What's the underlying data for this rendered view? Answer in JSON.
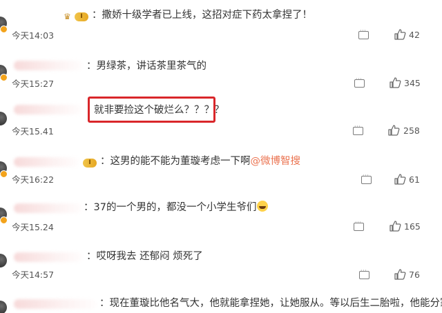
{
  "comments": [
    {
      "text": "：撒娇十级学者已上线，这招对症下药太拿捏了！",
      "time": "今天14:03",
      "likes": "42",
      "level": "I",
      "has_crown": true
    },
    {
      "text": "：男绿茶，讲话茶里茶气的",
      "time": "今天15:27",
      "likes": "345"
    },
    {
      "text": "就非要捡这个破烂么？？？？",
      "time": "今天15.41",
      "likes": "258",
      "highlighted": true
    },
    {
      "text_prefix": "：这男的能不能为董璇考虑一下啊",
      "mention": "@微博智搜",
      "time": "今天16:22",
      "likes": "61",
      "level": "I"
    },
    {
      "text": "：37的一个男的，都没一个小学生爷们",
      "time": "今天15.24",
      "likes": "165",
      "emoji": "laughing-emoji"
    },
    {
      "text": "：哎呀我去 还郁闷 烦死了",
      "time": "今天14:57",
      "likes": "76"
    },
    {
      "text": "：现在董璇比他名气大，他就能拿捏她，让她服从。等以后生二胎啦，他能分家产"
    }
  ],
  "colors": {
    "highlight": "#d9262a",
    "mention": "#eb7350",
    "level_badge": "#e7a823"
  }
}
